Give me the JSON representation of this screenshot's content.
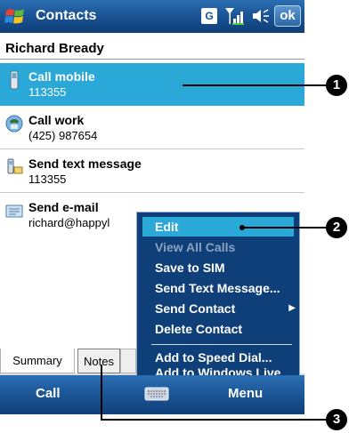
{
  "titlebar": {
    "title": "Contacts",
    "g_indicator": "G",
    "ok_label": "ok"
  },
  "contact": {
    "name": "Richard Bready"
  },
  "items": [
    {
      "label": "Call mobile",
      "value": "113355",
      "icon": "mobile-phone-icon",
      "selected": true
    },
    {
      "label": "Call work",
      "value": "(425) 987654",
      "icon": "work-phone-icon",
      "selected": false
    },
    {
      "label": "Send text message",
      "value": "113355",
      "icon": "text-message-icon",
      "selected": false
    },
    {
      "label": "Send e-mail",
      "value": "richard@happyl",
      "icon": "email-icon",
      "selected": false
    }
  ],
  "context_menu": {
    "items": [
      {
        "label": "Edit",
        "state": "highlighted"
      },
      {
        "label": "View All Calls",
        "state": "disabled"
      },
      {
        "label": "Save to SIM",
        "state": "normal"
      },
      {
        "label": "Send Text Message...",
        "state": "normal"
      },
      {
        "label": "Send Contact",
        "state": "normal",
        "submenu": true
      },
      {
        "label": "Delete Contact",
        "state": "normal"
      },
      {
        "label": "Add to Speed Dial...",
        "state": "normal"
      },
      {
        "label": "Add to Windows Live",
        "state": "normal"
      }
    ]
  },
  "tabs": [
    {
      "label": "Summary"
    },
    {
      "label": "Notes"
    }
  ],
  "menubar": {
    "left_softkey": "Call",
    "right_softkey": "Menu"
  },
  "callouts": [
    {
      "number": "1"
    },
    {
      "number": "2"
    },
    {
      "number": "3"
    }
  ],
  "colors": {
    "titlebar": "#1b5596",
    "selection": "#2aa8d8",
    "menu_background": "#0f3f78"
  }
}
